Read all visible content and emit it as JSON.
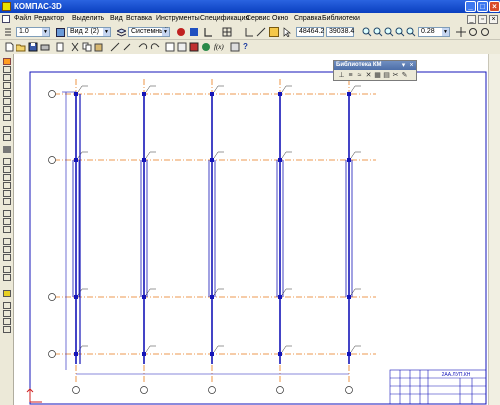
{
  "window": {
    "title": "КОМПАС-3D"
  },
  "menu": [
    {
      "label": "Файл"
    },
    {
      "label": "Редактор"
    },
    {
      "label": "Выделить"
    },
    {
      "label": "Вид"
    },
    {
      "label": "Вставка"
    },
    {
      "label": "Инструменты"
    },
    {
      "label": "Спецификация"
    },
    {
      "label": "Сервис"
    },
    {
      "label": "Окно"
    },
    {
      "label": "Справка"
    },
    {
      "label": "Библиотеки"
    }
  ],
  "toolbar": {
    "scale_value": "1.0",
    "view_value": "Вид 2 (2)",
    "layer_value": "Системный",
    "coord_x": "48464.2",
    "coord_y": "39038.4",
    "zoom_value": "0.28"
  },
  "library_panel": {
    "title": "Библиотека КМ"
  },
  "drawing": {
    "stamp_code": "2АА.ЛУП.КН"
  },
  "colors": {
    "drawing_blue": "#1515b8",
    "axis_orange": "#e87a1a",
    "titlebar_blue": "#0a3fbf"
  }
}
